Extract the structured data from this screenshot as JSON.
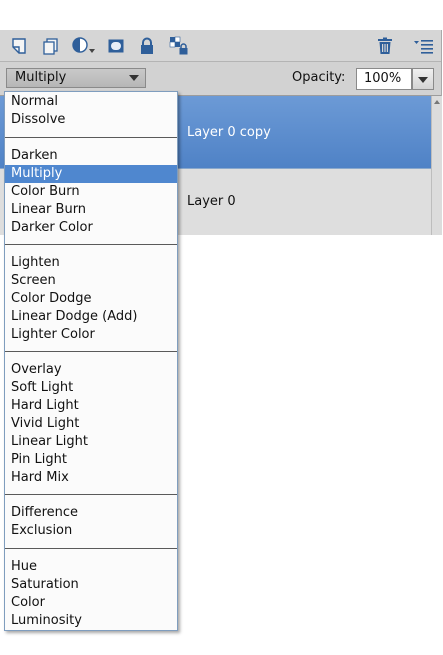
{
  "toolbar": {
    "icons": [
      "new-layer-icon",
      "new-group-icon",
      "adjustment-layer-icon",
      "layer-mask-icon",
      "lock-all-icon",
      "lock-transparent-icon",
      "trash-icon",
      "panel-menu-icon"
    ]
  },
  "blend_mode": {
    "selected": "Multiply"
  },
  "opacity": {
    "label": "Opacity:",
    "value": "100%"
  },
  "layers": [
    {
      "name": "Layer 0 copy",
      "selected": true
    },
    {
      "name": "Layer 0",
      "selected": false
    }
  ],
  "blend_menu": {
    "groups": [
      [
        "Normal",
        "Dissolve"
      ],
      [
        "Darken",
        "Multiply",
        "Color Burn",
        "Linear Burn",
        "Darker Color"
      ],
      [
        "Lighten",
        "Screen",
        "Color Dodge",
        "Linear Dodge (Add)",
        "Lighter Color"
      ],
      [
        "Overlay",
        "Soft Light",
        "Hard Light",
        "Vivid Light",
        "Linear Light",
        "Pin Light",
        "Hard Mix"
      ],
      [
        "Difference",
        "Exclusion"
      ],
      [
        "Hue",
        "Saturation",
        "Color",
        "Luminosity"
      ]
    ]
  },
  "colors": {
    "selection": "#4f87cf",
    "selected_layer": "#5b8bcc",
    "panel_bg": "#d9d9d9"
  }
}
